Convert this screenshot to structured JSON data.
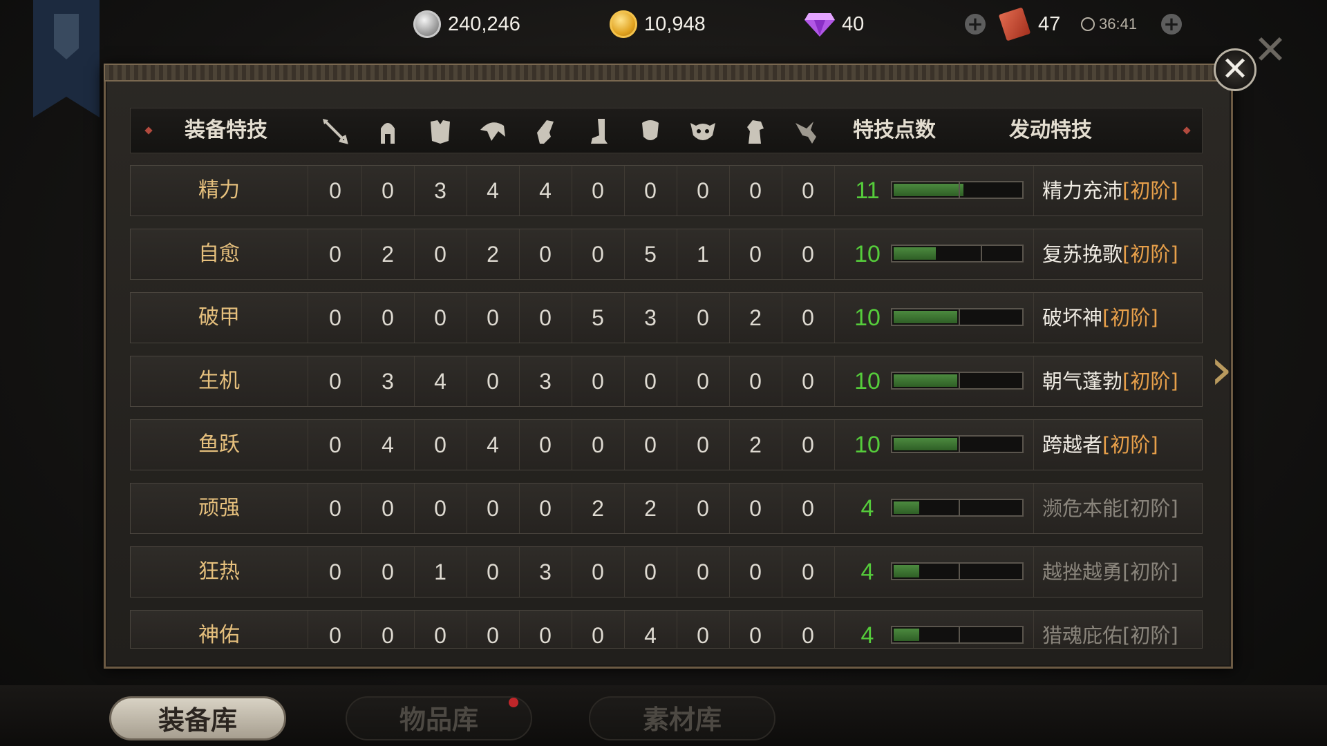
{
  "resources": {
    "silver": "240,246",
    "gold": "10,948",
    "diamonds": "40",
    "tickets": "47",
    "timer": "36:41"
  },
  "table": {
    "header": {
      "name_col": "装备特技",
      "points_col": "特技点数",
      "skill_col": "发动特技",
      "slot_icons": [
        "sword-icon",
        "helmet-icon",
        "armor-icon",
        "shoulder-icon",
        "glove-icon",
        "boot-icon",
        "shield-icon",
        "mask-icon",
        "horse-icon",
        "bird-icon"
      ]
    },
    "rows": [
      {
        "name": "精力",
        "values": [
          "0",
          "0",
          "3",
          "4",
          "4",
          "0",
          "0",
          "0",
          "0",
          "0"
        ],
        "points": "11",
        "progress": 0.55,
        "skill": "精力充沛",
        "tag": "[初阶]",
        "active": true
      },
      {
        "name": "自愈",
        "values": [
          "0",
          "2",
          "0",
          "2",
          "0",
          "0",
          "5",
          "1",
          "0",
          "0"
        ],
        "points": "10",
        "progress": 0.33,
        "skill": "复苏挽歌",
        "tag": "[初阶]",
        "active": true
      },
      {
        "name": "破甲",
        "values": [
          "0",
          "0",
          "0",
          "0",
          "0",
          "5",
          "3",
          "0",
          "2",
          "0"
        ],
        "points": "10",
        "progress": 0.5,
        "skill": "破坏神",
        "tag": "[初阶]",
        "active": true
      },
      {
        "name": "生机",
        "values": [
          "0",
          "3",
          "4",
          "0",
          "3",
          "0",
          "0",
          "0",
          "0",
          "0"
        ],
        "points": "10",
        "progress": 0.5,
        "skill": "朝气蓬勃",
        "tag": "[初阶]",
        "active": true
      },
      {
        "name": "鱼跃",
        "values": [
          "0",
          "4",
          "0",
          "4",
          "0",
          "0",
          "0",
          "0",
          "2",
          "0"
        ],
        "points": "10",
        "progress": 0.5,
        "skill": "跨越者",
        "tag": "[初阶]",
        "active": true
      },
      {
        "name": "顽强",
        "values": [
          "0",
          "0",
          "0",
          "0",
          "0",
          "2",
          "2",
          "0",
          "0",
          "0"
        ],
        "points": "4",
        "progress": 0.2,
        "skill": "濒危本能",
        "tag": "[初阶]",
        "active": false
      },
      {
        "name": "狂热",
        "values": [
          "0",
          "0",
          "1",
          "0",
          "3",
          "0",
          "0",
          "0",
          "0",
          "0"
        ],
        "points": "4",
        "progress": 0.2,
        "skill": "越挫越勇",
        "tag": "[初阶]",
        "active": false
      },
      {
        "name": "神佑",
        "values": [
          "0",
          "0",
          "0",
          "0",
          "0",
          "0",
          "4",
          "0",
          "0",
          "0"
        ],
        "points": "4",
        "progress": 0.2,
        "skill": "猎魂庇佑",
        "tag": "[初阶]",
        "active": false
      }
    ]
  },
  "tabs": [
    {
      "label": "装备库",
      "active": true
    },
    {
      "label": "物品库",
      "active": false
    },
    {
      "label": "素材库",
      "active": false
    }
  ],
  "colors": {
    "points_green": "#55cc3b",
    "tag_orange": "#e8a04a",
    "name_gold": "#e6c07d"
  }
}
